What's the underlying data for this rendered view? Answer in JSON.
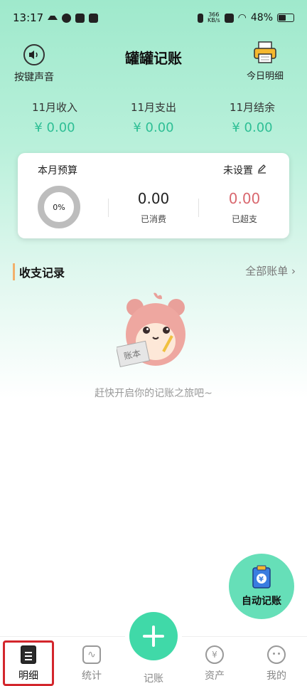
{
  "status_bar": {
    "time": "13:17",
    "net_speed": "366",
    "net_unit": "KB/s",
    "battery": "48%"
  },
  "header": {
    "title": "罐罐记账",
    "sound_label": "按键声音",
    "today_label": "今日明细"
  },
  "summary": [
    {
      "label": "11月收入",
      "value": "¥ 0.00"
    },
    {
      "label": "11月支出",
      "value": "¥ 0.00"
    },
    {
      "label": "11月结余",
      "value": "¥ 0.00"
    }
  ],
  "budget": {
    "title": "本月预算",
    "status": "未设置",
    "percent": "0%",
    "spent_value": "0.00",
    "spent_label": "已消费",
    "over_value": "0.00",
    "over_label": "已超支"
  },
  "records": {
    "title": "收支记录",
    "all_bills": "全部账单",
    "empty_text": "赶快开启你的记账之旅吧~"
  },
  "mascot": {
    "book_text": "账本"
  },
  "auto_fab": {
    "label": "自动记账",
    "badge": "¥"
  },
  "tabbar": {
    "tabs": [
      {
        "label": "明细"
      },
      {
        "label": "统计"
      },
      {
        "label": "记账"
      },
      {
        "label": "资产"
      },
      {
        "label": "我的"
      }
    ],
    "asset_symbol": "¥"
  },
  "colors": {
    "accent": "#40d9a8",
    "income_green": "#2ebf95",
    "over_red": "#d9686f",
    "highlight": "#d3262c"
  }
}
